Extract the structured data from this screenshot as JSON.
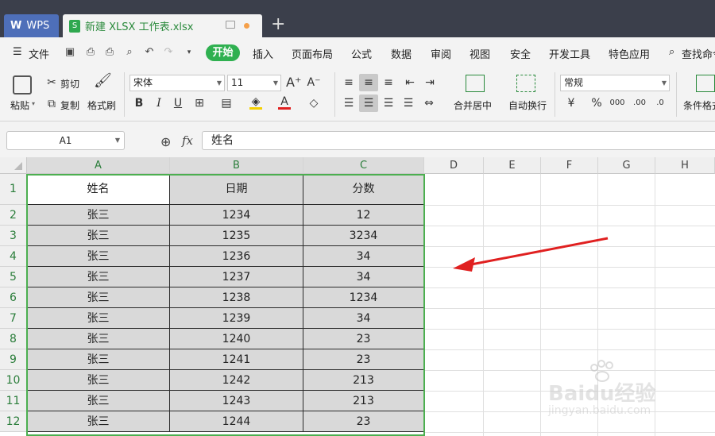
{
  "tabs": {
    "wps": "WPS",
    "file": "新建 XLSX 工作表.xlsx",
    "new_tab": "+"
  },
  "menu": {
    "file": "文件",
    "start": "开始",
    "items": [
      "插入",
      "页面布局",
      "公式",
      "数据",
      "审阅",
      "视图",
      "安全",
      "开发工具",
      "特色应用"
    ],
    "search": "查找命令"
  },
  "ribbon": {
    "paste": "粘贴",
    "cut": "剪切",
    "copy": "复制",
    "format_painter": "格式刷",
    "font": "宋体",
    "font_size": "11",
    "merge_center": "合并居中",
    "wrap_text": "自动换行",
    "number_format": "常规",
    "conditional_format": "条件格式"
  },
  "formula_bar": {
    "cell_ref": "A1",
    "fx": "fx",
    "value": "姓名"
  },
  "sheet": {
    "columns": [
      "A",
      "B",
      "C",
      "D",
      "E",
      "F",
      "G",
      "H"
    ],
    "rows": [
      "1",
      "2",
      "3",
      "4",
      "5",
      "6",
      "7",
      "8",
      "9",
      "10",
      "11",
      "12"
    ],
    "header": [
      "姓名",
      "日期",
      "分数"
    ],
    "data": [
      [
        "张三",
        "1234",
        "12"
      ],
      [
        "张三",
        "1235",
        "3234"
      ],
      [
        "张三",
        "1236",
        "34"
      ],
      [
        "张三",
        "1237",
        "34"
      ],
      [
        "张三",
        "1238",
        "1234"
      ],
      [
        "张三",
        "1239",
        "34"
      ],
      [
        "张三",
        "1240",
        "23"
      ],
      [
        "张三",
        "1241",
        "23"
      ],
      [
        "张三",
        "1242",
        "213"
      ],
      [
        "张三",
        "1243",
        "213"
      ],
      [
        "张三",
        "1244",
        "23"
      ]
    ]
  },
  "watermark": {
    "text": "Baidu经验",
    "url": "jingyan.baidu.com"
  },
  "colors": {
    "accent_green": "#2fb050",
    "selection_border": "#4caf50",
    "tab_blue": "#4e6fb9",
    "annotation_red": "#e02020"
  }
}
